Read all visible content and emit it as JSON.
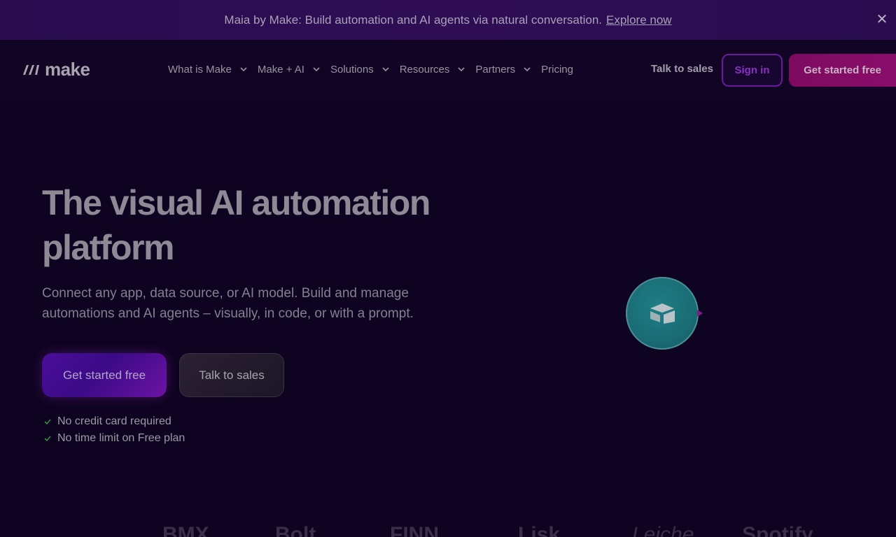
{
  "banner": {
    "message": "Maia by Make: Build automation and AI agents via natural conversation.",
    "link": "Explore now",
    "close_icon": "close-icon"
  },
  "header": {
    "logo_text": "make",
    "nav": [
      {
        "label": "What is Make",
        "has_dropdown": true
      },
      {
        "label": "Make + AI",
        "has_dropdown": true
      },
      {
        "label": "Solutions",
        "has_dropdown": true
      },
      {
        "label": "Resources",
        "has_dropdown": true
      },
      {
        "label": "Partners",
        "has_dropdown": true
      },
      {
        "label": "Pricing",
        "has_dropdown": false
      }
    ],
    "talk_to_sales": "Talk to sales",
    "sign_in": "Sign in",
    "get_started": "Get started free"
  },
  "hero": {
    "title": "The visual AI automation platform",
    "subtitle": "Connect any app, data source, or AI model. Build and manage automations and AI agents – visually, in code, or with a prompt.",
    "primary_cta": "Get started free",
    "secondary_cta": "Talk to sales",
    "checks": [
      "No credit card required",
      "No time limit on Free plan"
    ]
  },
  "app_bubble": {
    "icon": "airtable-icon"
  },
  "logo_strip": [
    "BMX",
    "Bolt",
    "FINN",
    "Lisk",
    "Leiche",
    "Spotify"
  ],
  "colors": {
    "background": "#0e0320",
    "banner": "#2a0c4f",
    "brand_purple": "#6a1a9a",
    "brand_magenta": "#8a0d6a",
    "check_green": "#3d8a3d"
  }
}
